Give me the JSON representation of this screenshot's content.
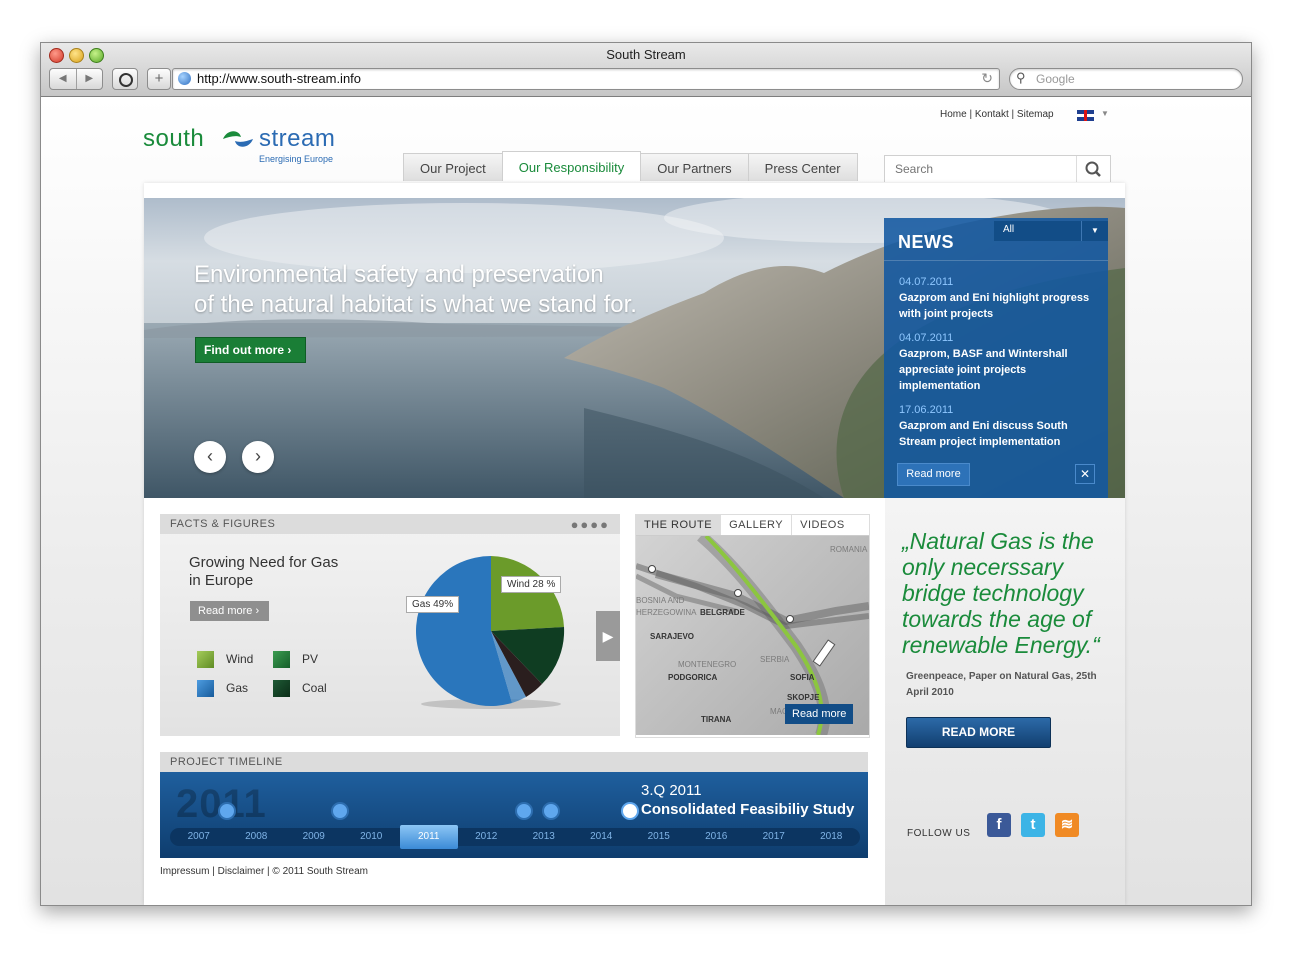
{
  "browser": {
    "window_title": "South Stream",
    "url": "http://www.south-stream.info",
    "search_placeholder": "Google"
  },
  "site": {
    "logo_left": "south",
    "logo_right": "stream",
    "tagline": "Energising Europe",
    "toplinks": [
      "Home",
      "Kontakt",
      "Sitemap"
    ],
    "nav": [
      "Our Project",
      "Our Responsibility",
      "Our Partners",
      "Press Center"
    ],
    "active_nav": "Our Responsibility",
    "search_placeholder": "Search"
  },
  "hero": {
    "line1": "Environmental safety and preservation",
    "line2": "of the natural habitat is what we stand for.",
    "cta": "Find out more"
  },
  "news": {
    "title": "NEWS",
    "filter": "All",
    "items": [
      {
        "date": "04.07.2011",
        "text": "Gazprom and Eni highlight progress with joint projects"
      },
      {
        "date": "04.07.2011",
        "text": "Gazprom, BASF and Wintershall appreciate joint projects implementation"
      },
      {
        "date": "17.06.2011",
        "text": "Gazprom and Eni discuss South Stream project implementation"
      }
    ],
    "read_more": "Read more"
  },
  "facts": {
    "header": "FACTS & FIGURES",
    "title_line1": "Growing Need for Gas",
    "title_line2": "in Europe",
    "read_more": "Read more",
    "legend": [
      "Wind",
      "PV",
      "Gas",
      "Coal"
    ],
    "pie_labels": [
      "Wind 28 %",
      "Gas 49%"
    ],
    "colors": {
      "wind": "#6b9b2a",
      "pv": "#1e6d33",
      "gas": "#2a76bc",
      "coal": "#0f3d22"
    }
  },
  "route": {
    "tabs": [
      "THE ROUTE",
      "GALLERY",
      "VIDEOS"
    ],
    "labels": [
      "ROMANIA",
      "BOSNIA AND",
      "HERZEGOWINA",
      "BELGRADE",
      "SARAJEVO",
      "SERBIA",
      "MONTENEGRO",
      "PODGORICA",
      "SOFIA",
      "SKOPJE",
      "MAC",
      "TIRANA"
    ],
    "read_more": "Read more"
  },
  "quote": {
    "text": "„Natural Gas is the only necerssary bridge technology towards the age of renewable Energy.“",
    "source": "Greenpeace, Paper on Natural Gas, 25th April 2010",
    "button": "READ MORE"
  },
  "follow": {
    "label": "FOLLOW US",
    "icons": [
      "facebook-icon",
      "twitter-icon",
      "rss-icon"
    ]
  },
  "timeline": {
    "header": "PROJECT TIMELINE",
    "big_year": "2011",
    "event_date": "3.Q 2011",
    "event_title": "Consolidated Feasibiliy Study",
    "years": [
      "2007",
      "2008",
      "2009",
      "2010",
      "2011",
      "2012",
      "2013",
      "2014",
      "2015",
      "2016",
      "2017",
      "2018"
    ],
    "active_year": "2011"
  },
  "footer": {
    "text": "Impressum | Disclaimer | © 2011 South Stream"
  }
}
